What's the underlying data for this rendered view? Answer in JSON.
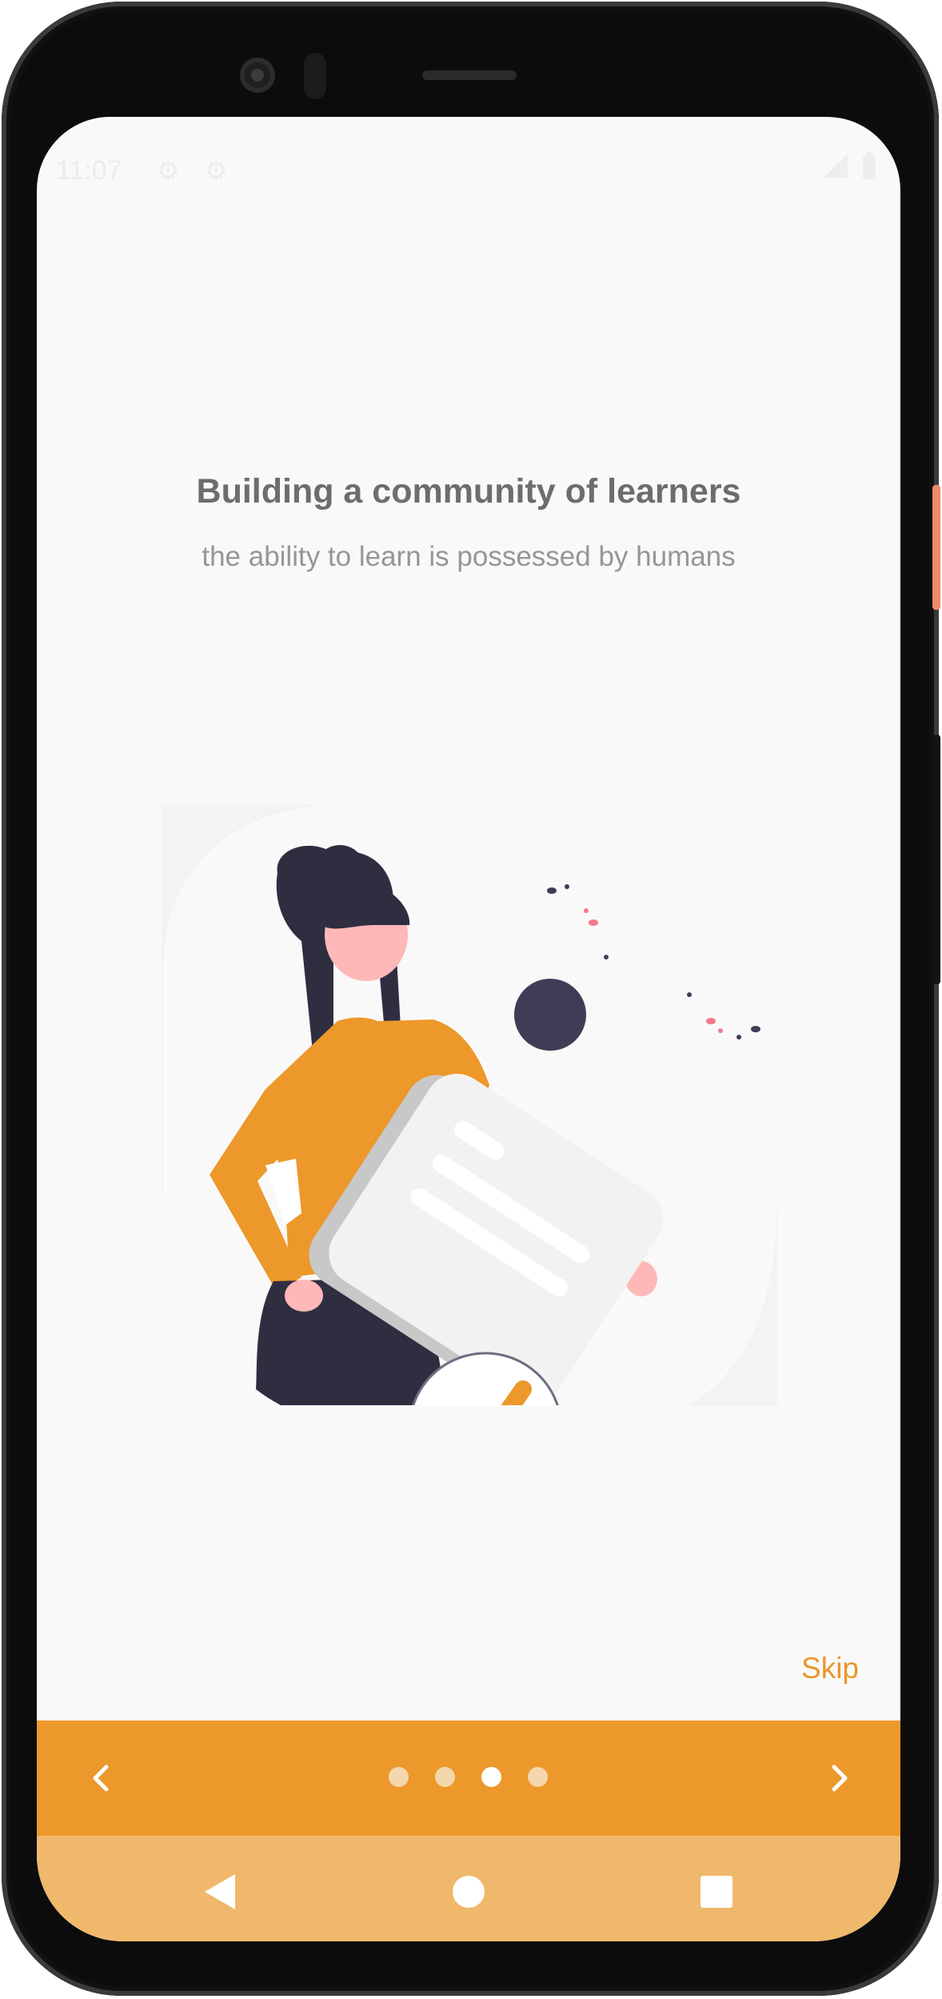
{
  "status_bar": {
    "time": "11:07"
  },
  "onboarding": {
    "title": "Building a community of learners",
    "subtitle": "the ability to learn is possessed by humans",
    "skip_label": "Skip",
    "page_count": 4,
    "active_page_index": 2
  },
  "icons": {
    "prev": "chevron-left-icon",
    "next": "chevron-right-icon",
    "back": "nav-back-icon",
    "home": "nav-home-icon",
    "recents": "nav-recents-icon",
    "settings": "gear-icon"
  },
  "colors": {
    "accent": "#ec982b",
    "nav_bar": "#f0b86b",
    "title": "#6d6d6d",
    "subtitle": "#969696",
    "background": "#f9f9f9"
  }
}
